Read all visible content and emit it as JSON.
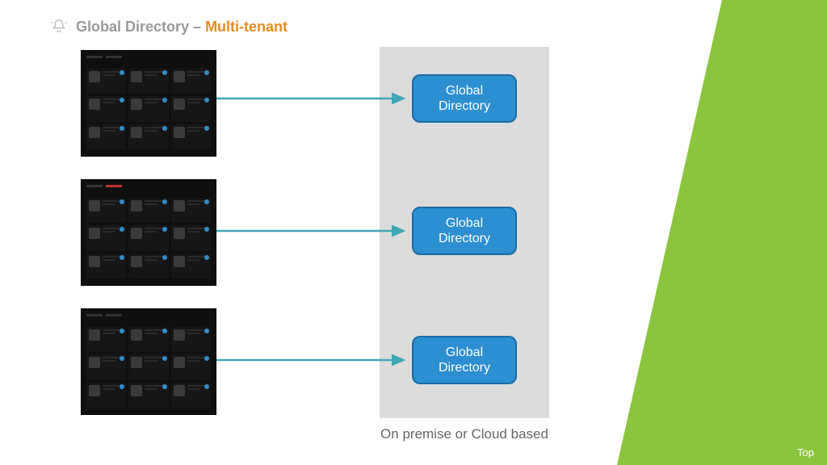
{
  "title": {
    "part1": "Global Directory – ",
    "part2": "Multi-tenant"
  },
  "boxes": {
    "gd1_line1": "Global",
    "gd1_line2": "Directory",
    "gd2_line1": "Global",
    "gd2_line2": "Directory",
    "gd3_line1": "Global",
    "gd3_line2": "Directory"
  },
  "caption": "On premise or Cloud based",
  "topLink": "Top",
  "diagram": {
    "type": "architecture",
    "description": "Three tenant application screenshots on the left each connect via arrow to their own Global Directory box inside a shared container labeled 'On premise or Cloud based'.",
    "tenants": 3,
    "target_label": "Global Directory",
    "container_label": "On premise or Cloud based"
  }
}
